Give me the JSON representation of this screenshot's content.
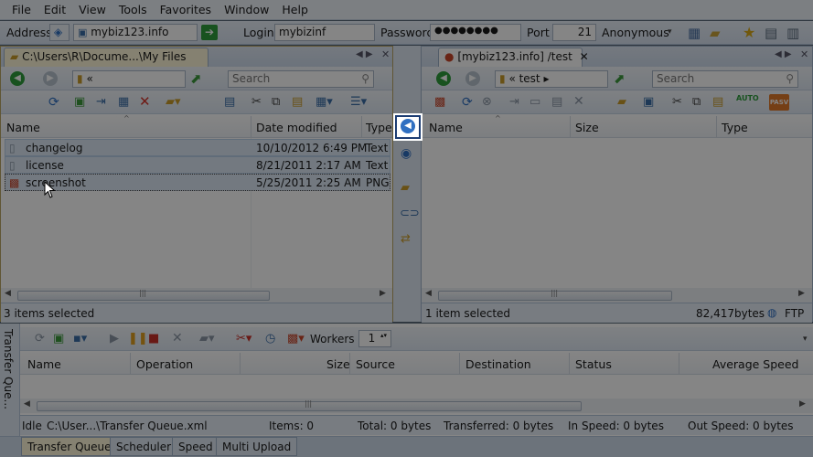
{
  "menu": [
    "File",
    "Edit",
    "View",
    "Tools",
    "Favorites",
    "Window",
    "Help"
  ],
  "connection": {
    "address_label": "Address",
    "address_value": "mybiz123.info",
    "login_label": "Login",
    "login_value": "mybizinf",
    "password_label": "Password",
    "password_value": "●●●●●●●●",
    "port_label": "Port",
    "port_value": "21",
    "anonymous_label": "Anonymous"
  },
  "local_pane": {
    "tab_title": "C:\\Users\\R\\Docume...\\My Files",
    "path_text": "«",
    "search_placeholder": "Search",
    "columns": {
      "name": "Name",
      "date": "Date modified",
      "type": "Type"
    },
    "files": [
      {
        "name": "changelog",
        "date": "10/10/2012 6:49 PM",
        "type": "Text"
      },
      {
        "name": "license",
        "date": "8/21/2011 2:17 AM",
        "type": "Text"
      },
      {
        "name": "screenshot",
        "date": "5/25/2011 2:25 AM",
        "type": "PNG"
      }
    ],
    "status": "3 items selected"
  },
  "remote_pane": {
    "tab_title": "[mybiz123.info] /test",
    "path_text": "« test ▸",
    "search_placeholder": "Search",
    "columns": {
      "name": "Name",
      "size": "Size",
      "type": "Type"
    },
    "status": "1 item selected",
    "size_value": "82,417",
    "size_unit": "bytes",
    "protocol": "FTP",
    "pasv": "PASV",
    "auto": "AUTO"
  },
  "queue": {
    "side_label": "Transfer Que...",
    "workers_label": "Workers",
    "workers_value": "1",
    "columns": {
      "name": "Name",
      "operation": "Operation",
      "size": "Size",
      "source": "Source",
      "destination": "Destination",
      "status": "Status",
      "avg_speed": "Average Speed"
    },
    "status_bar": {
      "state": "Idle",
      "file": "C:\\User...\\Transfer Queue.xml",
      "items": "Items: 0",
      "total": "Total: 0 bytes",
      "transferred": "Transferred: 0 bytes",
      "in_speed": "In Speed: 0 bytes",
      "out_speed": "Out Speed: 0 bytes"
    },
    "tabs": [
      "Transfer Queue",
      "Scheduler",
      "Speed",
      "Multi Upload"
    ]
  },
  "colors": {
    "accent_tab": "#fff8d8",
    "ftp_blue": "#2f6fc1",
    "highlight_border": "#ffffff"
  }
}
